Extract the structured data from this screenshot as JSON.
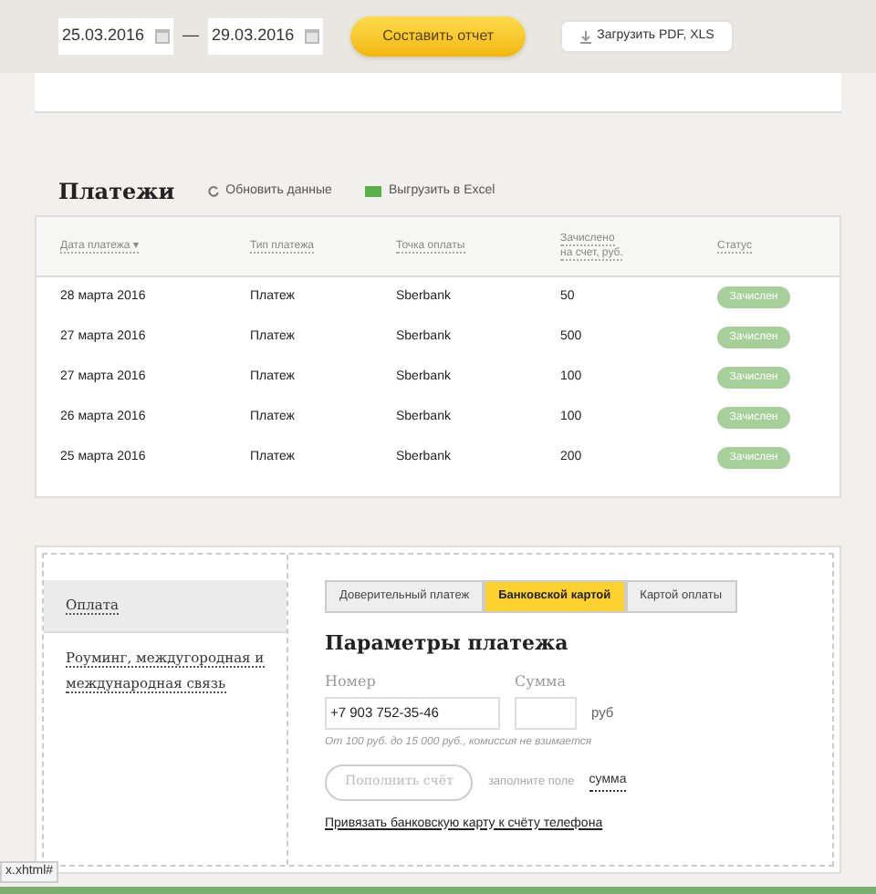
{
  "report_bar": {
    "date_from": "25.03.2016",
    "separator": "—",
    "date_to": "29.03.2016",
    "report_button": "Составить отчет",
    "download_button": "Загрузить PDF, XLS"
  },
  "payments": {
    "title": "Платежи",
    "refresh_link": "Обновить данные",
    "excel_link": "Выгрузить в Excel",
    "columns": [
      {
        "label": "Дата платежа ▾"
      },
      {
        "label": "Тип платежа"
      },
      {
        "label": "Точка оплаты"
      },
      {
        "label": "Зачислено\nна счет,  руб."
      },
      {
        "label": "Статус"
      }
    ],
    "rows": [
      {
        "date": "28 марта 2016",
        "type": "Платеж",
        "point": "Sberbank",
        "amount": "50",
        "status": "Зачислен"
      },
      {
        "date": "27 марта 2016",
        "type": "Платеж",
        "point": "Sberbank",
        "amount": "500",
        "status": "Зачислен"
      },
      {
        "date": "27 марта 2016",
        "type": "Платеж",
        "point": "Sberbank",
        "amount": "100",
        "status": "Зачислен"
      },
      {
        "date": "26 марта 2016",
        "type": "Платеж",
        "point": "Sberbank",
        "amount": "100",
        "status": "Зачислен"
      },
      {
        "date": "25 марта 2016",
        "type": "Платеж",
        "point": "Sberbank",
        "amount": "200",
        "status": "Зачислен"
      }
    ]
  },
  "payment_panel": {
    "side_menu": [
      {
        "label": "Оплата",
        "selected": true
      },
      {
        "label": "Роуминг, междугородная и международная связь",
        "selected": false
      }
    ],
    "tabs": [
      {
        "label": "Доверительный платеж",
        "selected": false
      },
      {
        "label": "Банковской картой",
        "selected": true
      },
      {
        "label": "Картой оплаты",
        "selected": false
      }
    ],
    "title": "Параметры платежа",
    "number_label": "Номер",
    "number_value": "+7 903 752-35-46",
    "sum_label": "Сумма",
    "currency": "руб",
    "hint": "От 100 руб. до 15 000 руб., комиссия не взимается",
    "submit_button": "Пополнить счёт",
    "submit_disabled": true,
    "fill_hint": "заполните поле",
    "fill_hint_link": "сумма",
    "bind_link": "Привязать банковскую карту к счёту телефона"
  },
  "status_bar": {
    "url": "x.xhtml#"
  }
}
